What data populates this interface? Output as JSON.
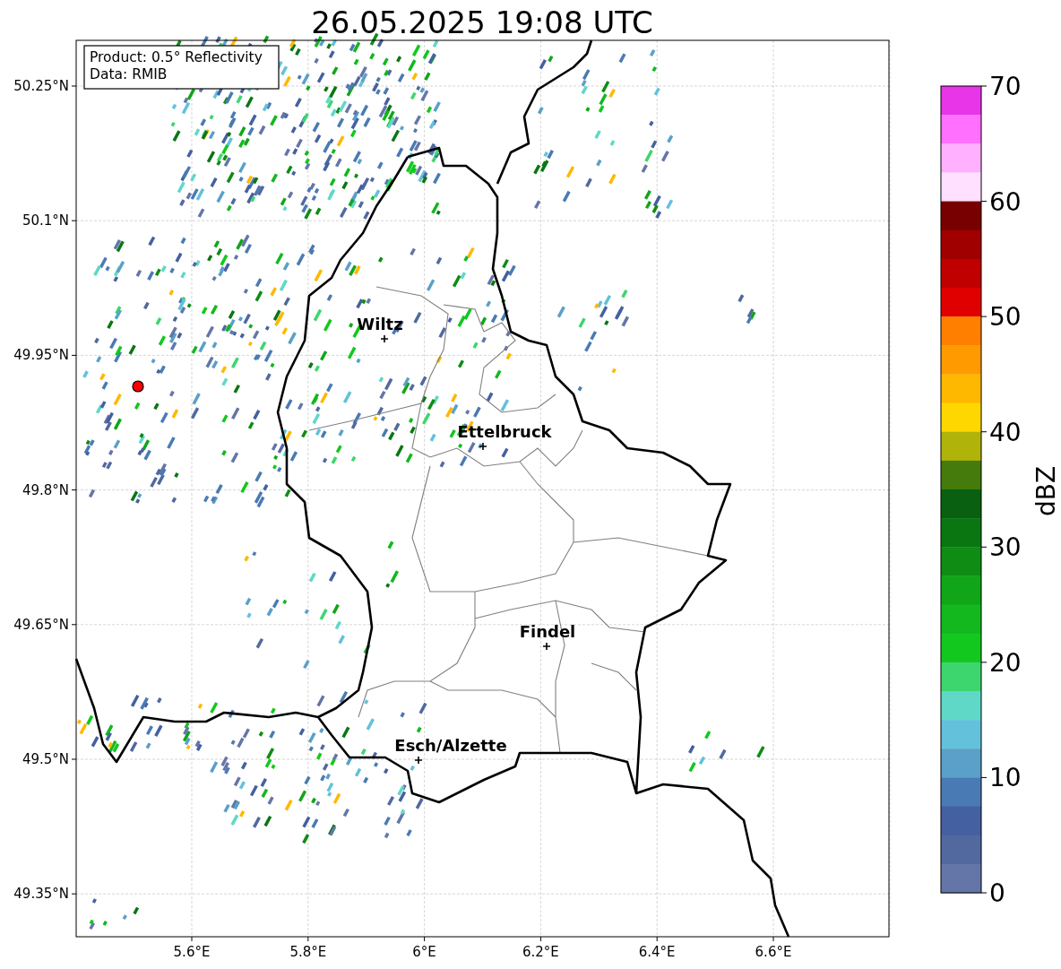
{
  "title": "26.05.2025 19:08 UTC",
  "info_box": {
    "lines": [
      "Product: 0.5° Reflectivity",
      "Data: RMIB"
    ]
  },
  "map": {
    "x_ticks": [
      "5.6°E",
      "5.8°E",
      "6°E",
      "6.2°E",
      "6.4°E",
      "6.6°E"
    ],
    "y_ticks": [
      "50.25°N",
      "50.1°N",
      "49.95°N",
      "49.8°N",
      "49.65°N",
      "49.5°N",
      "49.35°N"
    ],
    "cities": [
      {
        "name": "Wiltz"
      },
      {
        "name": "Ettelbruck"
      },
      {
        "name": "Findel"
      },
      {
        "name": "Esch/Alzette"
      }
    ],
    "radar_station": {
      "color": "#ff0000"
    }
  },
  "colorbar": {
    "label": "dBZ",
    "ticks": [
      "70",
      "60",
      "50",
      "40",
      "30",
      "20",
      "10",
      "0"
    ],
    "bins": [
      {
        "color": "#e835e8"
      },
      {
        "color": "#ff70ff"
      },
      {
        "color": "#ffb0ff"
      },
      {
        "color": "#ffe0ff"
      },
      {
        "color": "#780000"
      },
      {
        "color": "#a00000"
      },
      {
        "color": "#c00000"
      },
      {
        "color": "#e00000"
      },
      {
        "color": "#ff7f00"
      },
      {
        "color": "#ff9a00"
      },
      {
        "color": "#ffb800"
      },
      {
        "color": "#ffd700"
      },
      {
        "color": "#b0b40a"
      },
      {
        "color": "#457a0c"
      },
      {
        "color": "#086010"
      },
      {
        "color": "#0a7612"
      },
      {
        "color": "#0e8c14"
      },
      {
        "color": "#10a618"
      },
      {
        "color": "#12b81e"
      },
      {
        "color": "#12c81e"
      },
      {
        "color": "#3dd66e"
      },
      {
        "color": "#5fd8c8"
      },
      {
        "color": "#63c1dc"
      },
      {
        "color": "#5aa0c8"
      },
      {
        "color": "#4a7ab3"
      },
      {
        "color": "#4560a0"
      },
      {
        "color": "#51699f"
      },
      {
        "color": "#6476a8"
      }
    ]
  }
}
